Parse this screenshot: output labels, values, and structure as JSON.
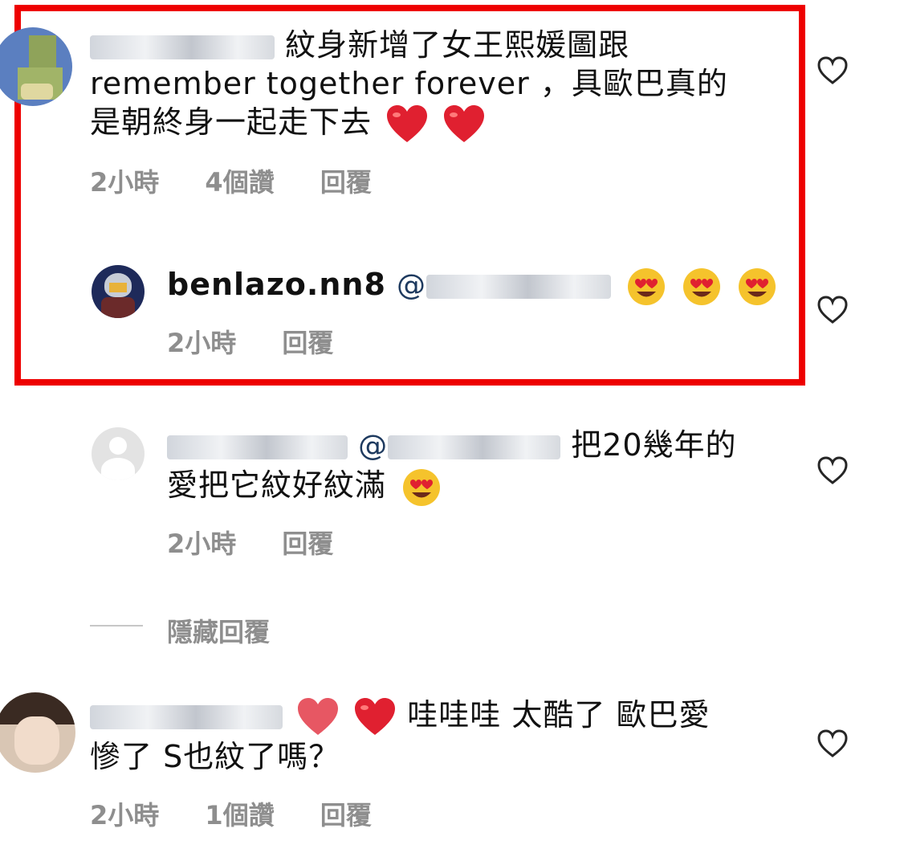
{
  "comments": [
    {
      "username_text": "cindichiang",
      "text_line1": "紋身新增了女王熙媛圖跟",
      "text_line2": "remember  together  forever ，具歐巴真的",
      "text_line3": "是朝終身一起走下去",
      "time": "2小時",
      "likes": "4個讚",
      "reply": "回覆"
    },
    {
      "username": "benlazo.nn8",
      "mention": "@cindichiang",
      "time": "2小時",
      "reply": "回覆"
    },
    {
      "username_text": "love125127",
      "mention": "@cindichiang",
      "text_line1": "把20幾年的",
      "text_line2": "愛把它紋好紋滿",
      "time": "2小時",
      "reply": "回覆"
    },
    {
      "username_text": "skk_cheung",
      "text_line1": "哇哇哇  太酷了  歐巴愛",
      "text_line2": "慘了  S也紋了嗎？",
      "time": "2小時",
      "likes": "1個讚",
      "reply": "回覆"
    }
  ],
  "hide_replies": "隱藏回覆",
  "colors": {
    "highlight": "#ee0000",
    "meta": "#8e8e8e",
    "mention": "#1e3a5f",
    "text": "#111111"
  },
  "icons": [
    "heart-outline-icon",
    "heart-eyes-emoji",
    "red-heart-emoji"
  ]
}
